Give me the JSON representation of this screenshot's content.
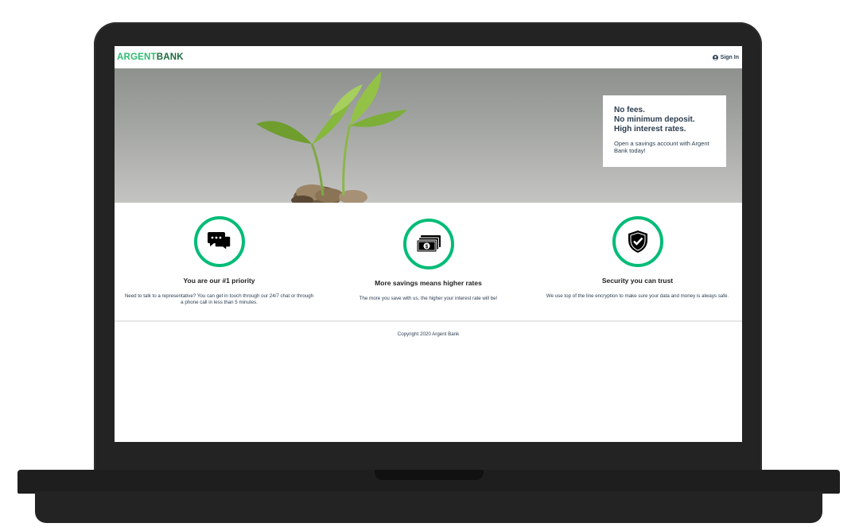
{
  "brand": {
    "part1": "ARGENT",
    "part2": "BANK"
  },
  "nav": {
    "signin_label": "Sign In"
  },
  "hero": {
    "subtitles": [
      "No fees.",
      "No minimum deposit.",
      "High interest rates."
    ],
    "text": "Open a savings account with Argent Bank today!"
  },
  "features": [
    {
      "icon": "chat-icon",
      "title": "You are our #1 priority",
      "text": "Need to talk to a representative? You can get in touch through our 24/7 chat or through a phone call in less than 5 minutes."
    },
    {
      "icon": "money-icon",
      "title": "More savings means higher rates",
      "text": "The more you save with us, the higher your interest rate will be!"
    },
    {
      "icon": "security-icon",
      "title": "Security you can trust",
      "text": "We use top of the line encryption to make sure your data and money is always safe."
    }
  ],
  "footer": {
    "copyright": "Copyright 2020 Argent Bank"
  },
  "colors": {
    "accent": "#00bc77",
    "logo_green": "#2ebd72",
    "logo_dark": "#1c6b3d",
    "text": "#2c3e50",
    "laptop": "#232323"
  }
}
